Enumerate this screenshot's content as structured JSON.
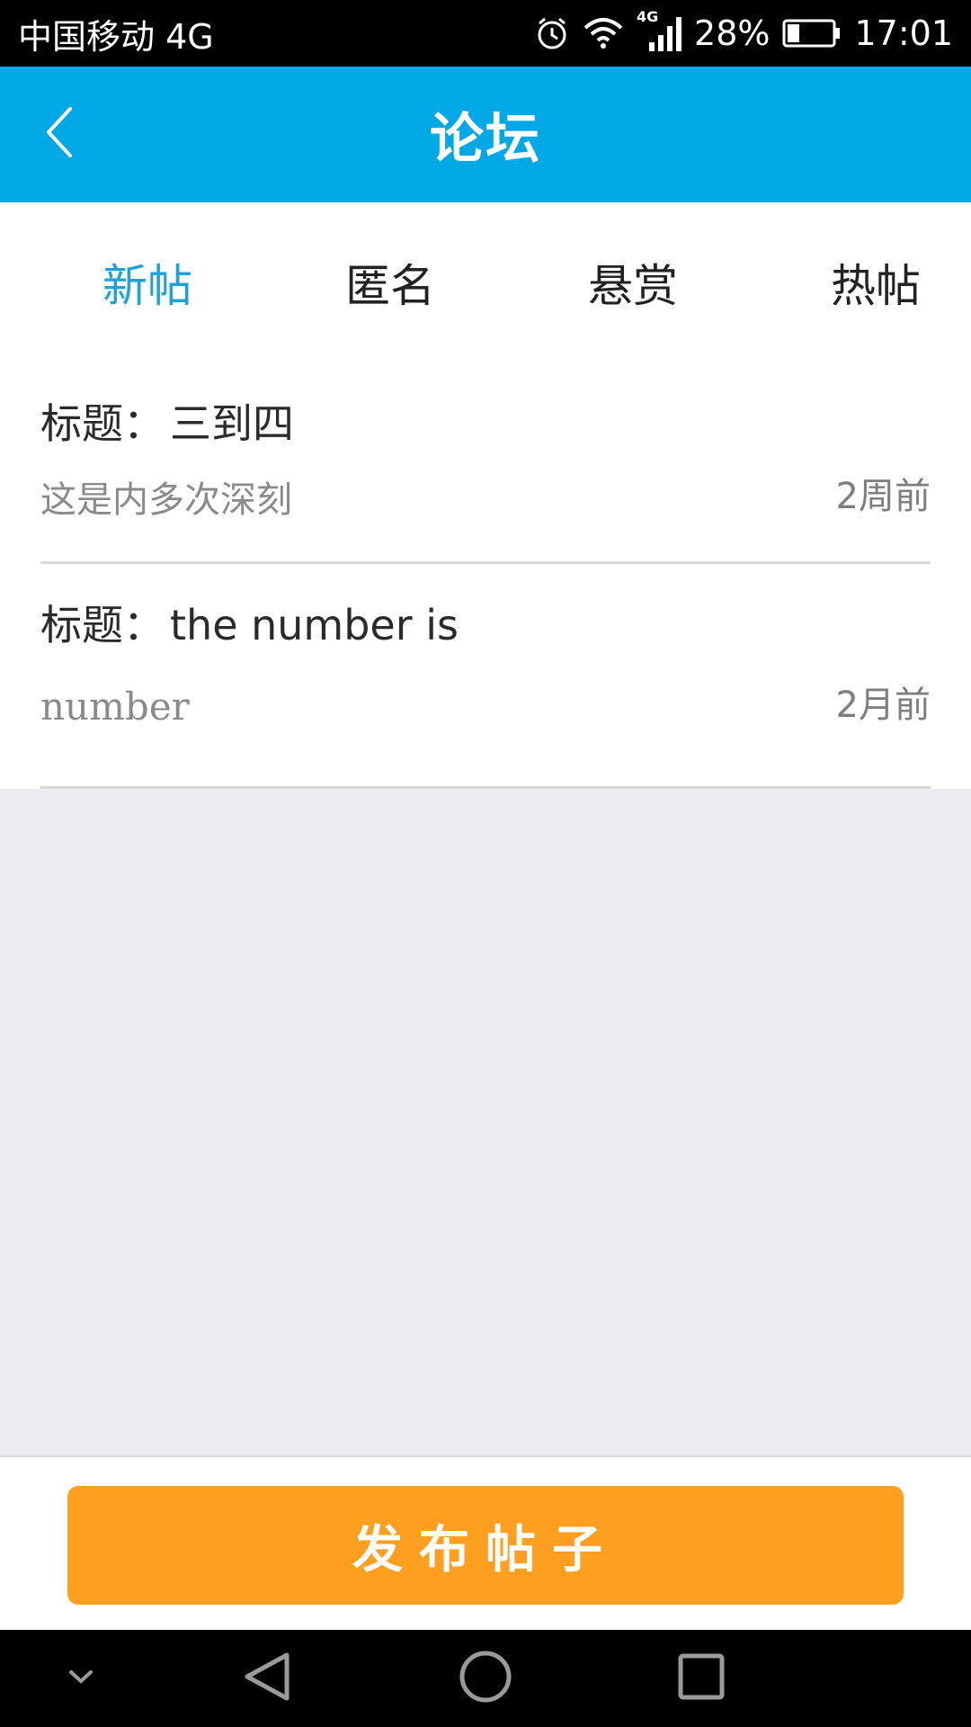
{
  "status_bar": {
    "carrier": "中国移动 4G",
    "network_badge": "4G",
    "battery_percent": "28%",
    "battery_level": 0.28,
    "time": "17:01",
    "icons": [
      "alarm-icon",
      "wifi-icon",
      "signal-icon",
      "battery-icon"
    ]
  },
  "header": {
    "title": "论坛",
    "back_icon": "chevron-left-icon"
  },
  "tabs": [
    {
      "label": "新帖",
      "active": true
    },
    {
      "label": "匿名",
      "active": false
    },
    {
      "label": "悬赏",
      "active": false
    },
    {
      "label": "热帖",
      "active": false
    }
  ],
  "posts": [
    {
      "title_label": "标题：",
      "title": "三到四",
      "excerpt": "这是内多次深刻",
      "time": "2周前"
    },
    {
      "title_label": "标题：",
      "title": "the number is",
      "excerpt": "number",
      "time": "2月前"
    }
  ],
  "actions": {
    "publish_label": "发布帖子"
  },
  "nav_bar": {
    "icons": [
      "chevron-down-icon",
      "back-triangle-icon",
      "home-circle-icon",
      "recent-square-icon"
    ]
  },
  "colors": {
    "header": "#00a8e6",
    "active_tab": "#1ea1d6",
    "publish_button": "#ff9f20",
    "page_background": "#ebedf1"
  }
}
